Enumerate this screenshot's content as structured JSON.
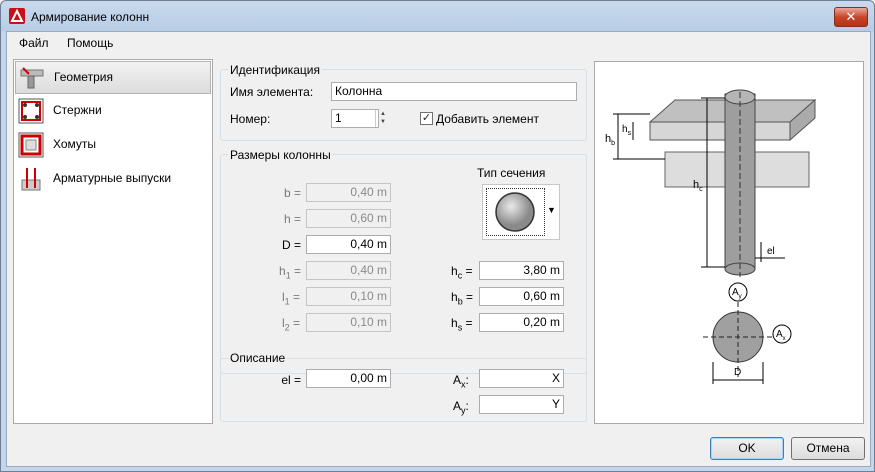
{
  "window": {
    "title": "Армирование колонн",
    "close_label": "✕"
  },
  "menu": {
    "file": "Файл",
    "help": "Помощь"
  },
  "nav": {
    "items": [
      {
        "label": "Геометрия",
        "icon": "geometry-icon",
        "selected": true
      },
      {
        "label": "Стержни",
        "icon": "rebars-icon",
        "selected": false
      },
      {
        "label": "Хомуты",
        "icon": "stirrups-icon",
        "selected": false
      },
      {
        "label": "Арматурные выпуски",
        "icon": "rebar-dowels-icon",
        "selected": false
      }
    ]
  },
  "identification": {
    "group_title": "Идентификация",
    "name_label": "Имя элемента:",
    "name_value": "Колонна",
    "number_label": "Номер:",
    "number_value": "1",
    "add_element_label": "Добавить элемент",
    "add_element_checked": true
  },
  "dimensions": {
    "group_title": "Размеры колонны",
    "section_type_label": "Тип сечения",
    "b_label": "b =",
    "b_value": "0,40 m",
    "h_label": "h =",
    "h_value": "0,60 m",
    "D_label": "D =",
    "D_value": "0,40 m",
    "h1_label": "h",
    "h1_sub": "1",
    "h1_value": "0,40 m",
    "l1_label": "l",
    "l1_sub": "1",
    "l1_value": "0,10 m",
    "l2_label": "l",
    "l2_sub": "2",
    "l2_value": "0,10 m",
    "hc_label": "h",
    "hc_sub": "c",
    "hc_value": "3,80 m",
    "hb_label": "h",
    "hb_sub": "b",
    "hb_value": "0,60 m",
    "hs_label": "h",
    "hs_sub": "s",
    "hs_value": "0,20 m",
    "eq": "="
  },
  "description": {
    "group_title": "Описание",
    "el_label": "el =",
    "el_value": "0,00 m",
    "ax_label": "A",
    "ax_sub": "x",
    "ax_value": "X",
    "ay_label": "A",
    "ay_sub": "y",
    "ay_value": "Y",
    "colon": ":"
  },
  "drawing": {
    "hs": "h",
    "hs_sub": "s",
    "hb": "h",
    "hb_sub": "b",
    "hc": "h",
    "hc_sub": "c",
    "el": "el",
    "ay": "A",
    "ay_sub": "y",
    "ax": "A",
    "ax_sub": "x",
    "d": "D"
  },
  "buttons": {
    "ok": "OK",
    "cancel": "Отмена"
  },
  "colors": {
    "accent": "#cc0000",
    "slab_top": "#c8c8c8",
    "column_fill": "#a0a0a0"
  }
}
